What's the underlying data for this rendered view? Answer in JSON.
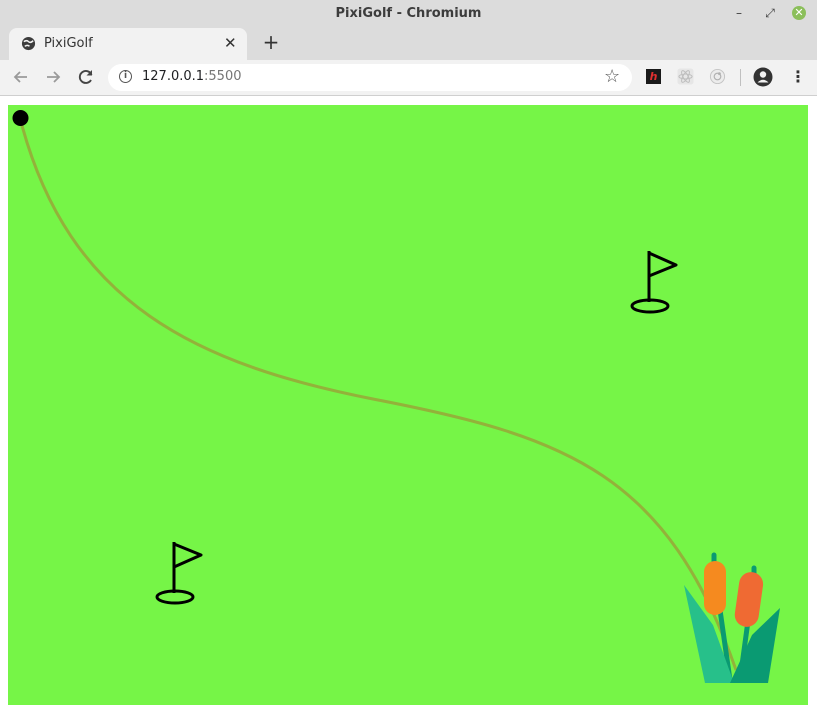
{
  "window": {
    "title": "PixiGolf - Chromium",
    "controls": {
      "minimize": "–",
      "maximize": "⤢",
      "close": "✕"
    }
  },
  "tabs": [
    {
      "title": "PixiGolf",
      "favicon": "globe-icon",
      "close_glyph": "✕",
      "active": true
    }
  ],
  "new_tab_glyph": "+",
  "toolbar": {
    "url_host": "127.0.0.1",
    "url_port": ":5500",
    "info_glyph": "i",
    "bookmark_glyph": "☆",
    "extensions": [
      {
        "name": "h-extension-icon",
        "glyph": "h"
      },
      {
        "name": "react-devtools-icon"
      },
      {
        "name": "extension-circle-icon"
      }
    ],
    "menu_glyph": "⋮"
  },
  "game": {
    "background_color": "#76f547",
    "ball_color": "#000000",
    "trajectory_color": "#93b23a",
    "flags": [
      {
        "name": "flag-hole-top-right"
      },
      {
        "name": "flag-hole-bottom-left"
      }
    ],
    "decoration": "cattail-reeds",
    "colors": {
      "cattail_orange": "#f58a1f",
      "cattail_red_orange": "#ef6a33",
      "leaf_teal": "#27c08a",
      "leaf_dark_teal": "#0a9a72"
    }
  }
}
